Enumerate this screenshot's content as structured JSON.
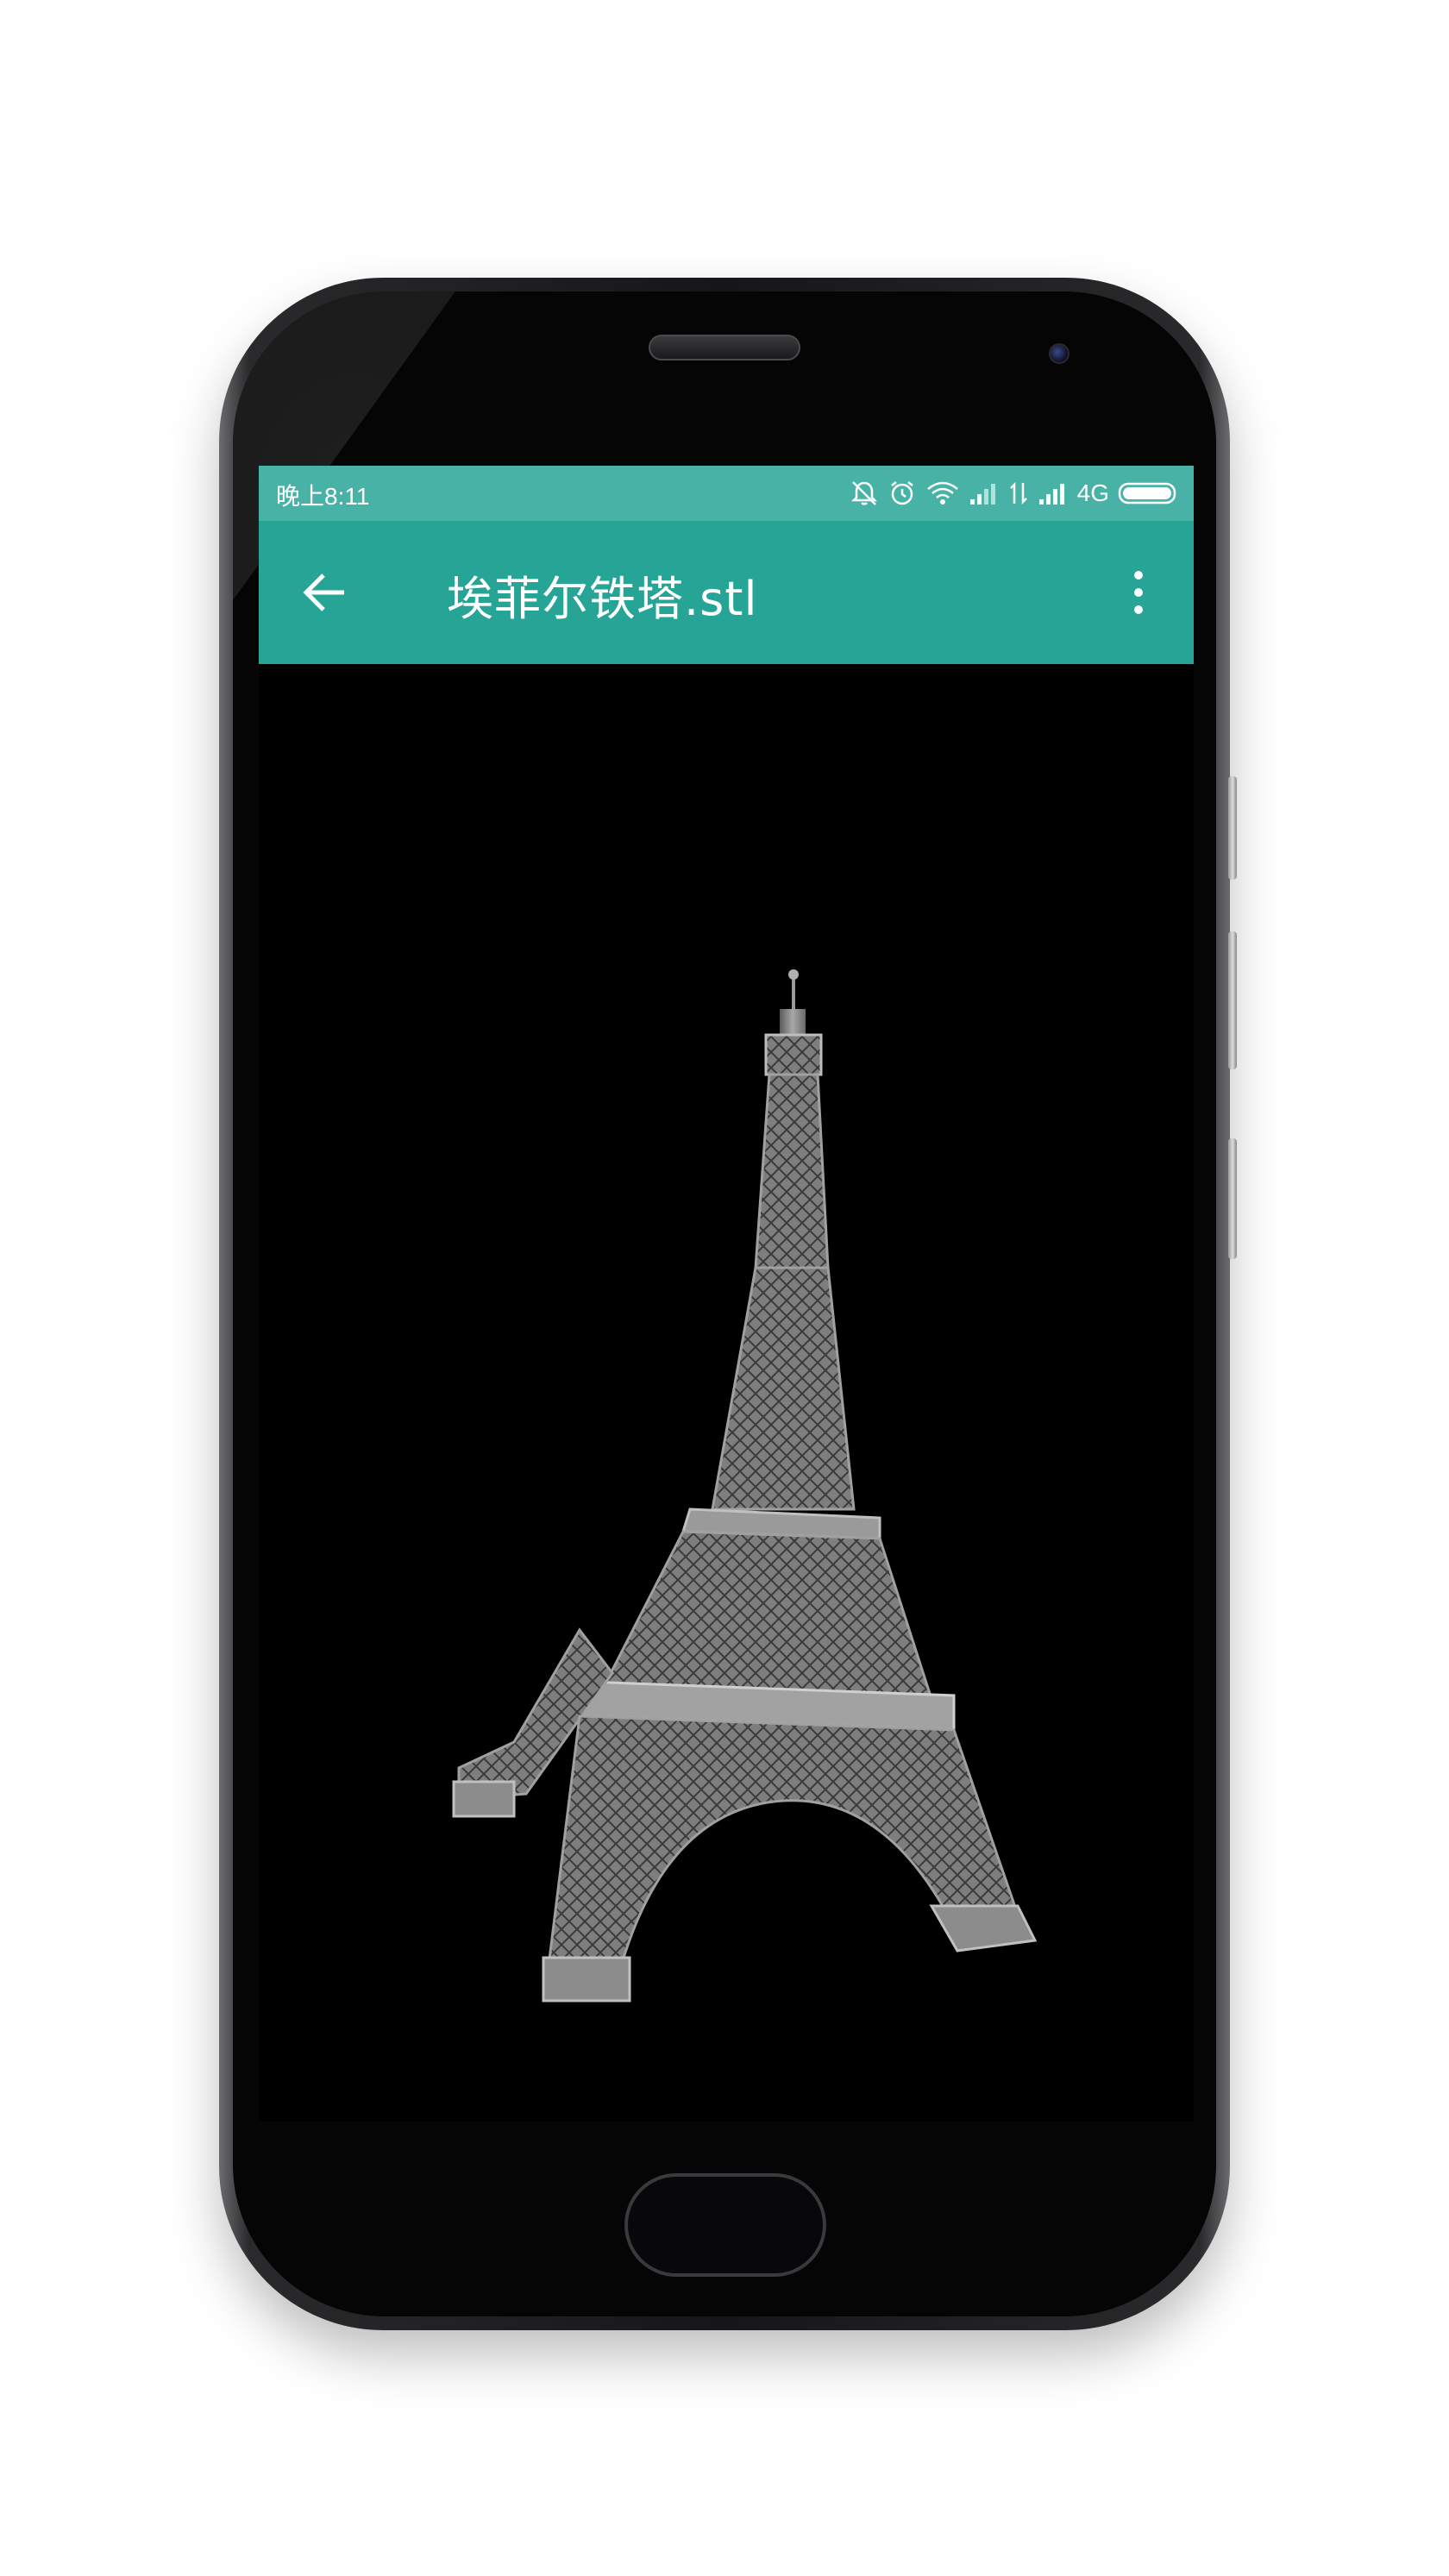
{
  "status_bar": {
    "time": "晚上8:11",
    "network": "4G",
    "icons": [
      "alarm-off-icon",
      "alarm-clock-icon",
      "wifi-icon",
      "signal-icon",
      "data-activity-icon",
      "signal-icon",
      "battery-icon"
    ]
  },
  "app_bar": {
    "title": "埃菲尔铁塔.stl",
    "back_icon": "arrow-back-icon",
    "menu_icon": "more-vert-icon"
  },
  "viewer": {
    "model": "eiffel-tower-3d-model"
  },
  "colors": {
    "status_bar": "#48b2a6",
    "app_bar": "#26a596",
    "viewer_background": "#000000",
    "model_gray": "#8c8c8c"
  }
}
